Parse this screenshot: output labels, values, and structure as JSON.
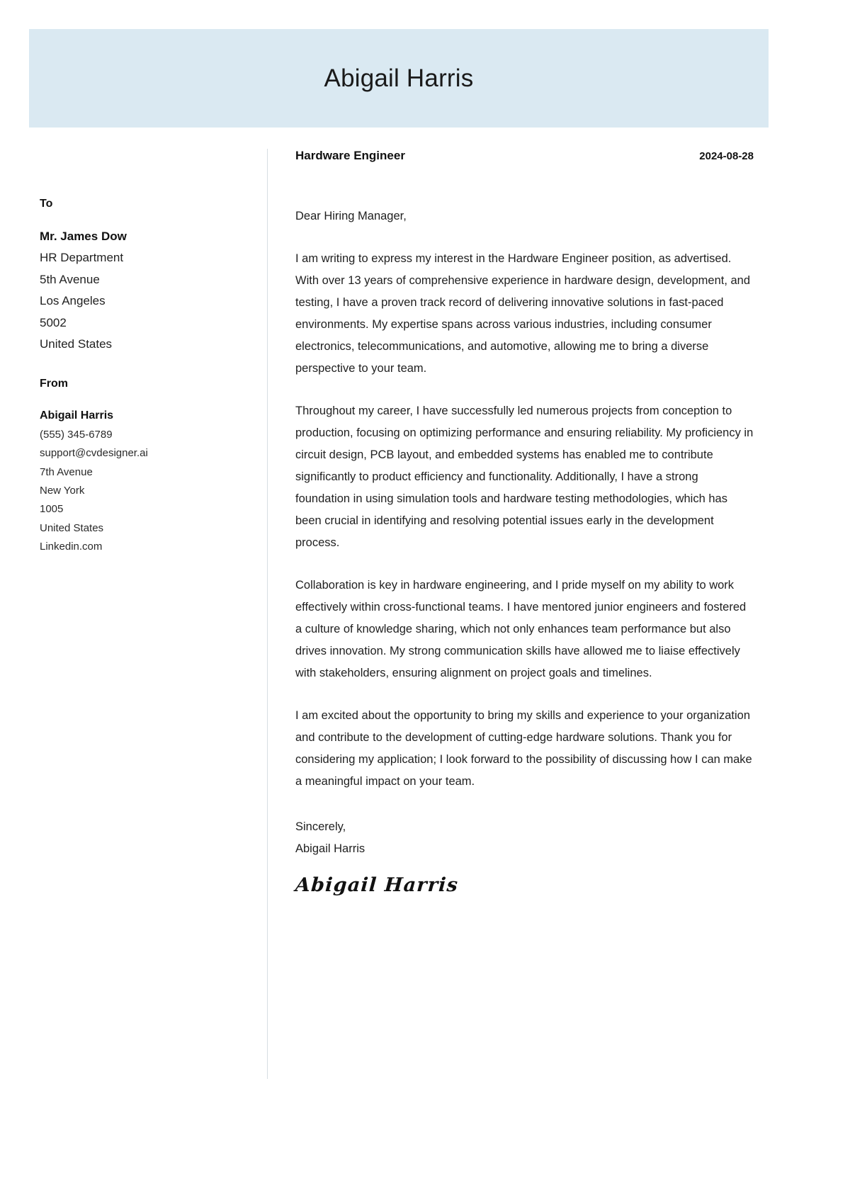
{
  "header": {
    "name": "Abigail Harris",
    "background_color": "#dae9f2"
  },
  "sidebar": {
    "to": {
      "heading": "To",
      "recipient_name": "Mr. James Dow",
      "lines": [
        "HR Department",
        "5th Avenue",
        "Los Angeles",
        "5002",
        "United States"
      ]
    },
    "from": {
      "heading": "From",
      "sender_name": "Abigail Harris",
      "lines": [
        "(555) 345-6789",
        "support@cvdesigner.ai",
        "7th Avenue",
        "New York",
        "1005",
        "United States",
        "Linkedin.com"
      ]
    }
  },
  "letter": {
    "job_title": "Hardware Engineer",
    "date": "2024-08-28",
    "salutation": "Dear Hiring Manager,",
    "paragraphs": [
      "I am writing to express my interest in the Hardware Engineer position, as advertised. With over 13 years of comprehensive experience in hardware design, development, and testing, I have a proven track record of delivering innovative solutions in fast-paced environments. My expertise spans across various industries, including consumer electronics, telecommunications, and automotive, allowing me to bring a diverse perspective to your team.",
      "Throughout my career, I have successfully led numerous projects from conception to production, focusing on optimizing performance and ensuring reliability. My proficiency in circuit design, PCB layout, and embedded systems has enabled me to contribute significantly to product efficiency and functionality. Additionally, I have a strong foundation in using simulation tools and hardware testing methodologies, which has been crucial in identifying and resolving potential issues early in the development process.",
      "Collaboration is key in hardware engineering, and I pride myself on my ability to work effectively within cross-functional teams. I have mentored junior engineers and fostered a culture of knowledge sharing, which not only enhances team performance but also drives innovation. My strong communication skills have allowed me to liaise effectively with stakeholders, ensuring alignment on project goals and timelines.",
      "I am excited about the opportunity to bring my skills and experience to your organization and contribute to the development of cutting-edge hardware solutions. Thank you for considering my application; I look forward to the possibility of discussing how I can make a meaningful impact on your team."
    ],
    "closing_word": "Sincerely,",
    "closing_name": "Abigail Harris",
    "signature": "Abigail Harris"
  }
}
